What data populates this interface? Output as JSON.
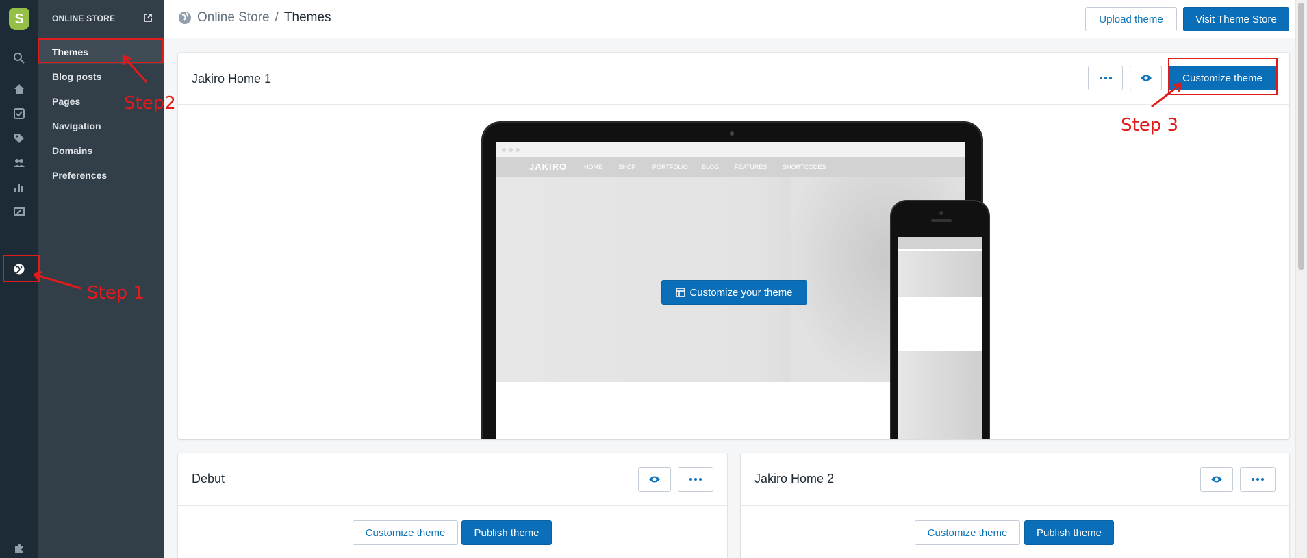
{
  "sidebar": {
    "section_title": "ONLINE STORE",
    "items": [
      {
        "label": "Themes"
      },
      {
        "label": "Blog posts"
      },
      {
        "label": "Pages"
      },
      {
        "label": "Navigation"
      },
      {
        "label": "Domains"
      },
      {
        "label": "Preferences"
      }
    ]
  },
  "header": {
    "breadcrumb_parent": "Online Store",
    "breadcrumb_separator": "/",
    "breadcrumb_current": "Themes",
    "upload_label": "Upload theme",
    "visit_store_label": "Visit Theme Store"
  },
  "current_theme": {
    "name": "Jakiro Home 1",
    "more_label": "...",
    "customize_label": "Customize theme",
    "overlay_customize_label": "Customize your theme",
    "preview": {
      "site_logo": "JAKIRO",
      "menu": [
        "HOME",
        "SHOP",
        "PORTFOLIO",
        "BLOG",
        "FEATURES",
        "SHORTCODES"
      ]
    }
  },
  "library_themes": [
    {
      "name": "Debut",
      "customize_label": "Customize theme",
      "publish_label": "Publish theme",
      "more_label": "..."
    },
    {
      "name": "Jakiro Home 2",
      "customize_label": "Customize theme",
      "publish_label": "Publish theme",
      "more_label": "..."
    }
  ],
  "annotations": {
    "step1": "Step 1",
    "step2": "Step2",
    "step3": "Step 3"
  },
  "colors": {
    "primary": "#0a6fb8",
    "annotation_red": "#e01b1b",
    "sidebar_bg": "#323e48",
    "rail_bg": "#1c2b35"
  }
}
